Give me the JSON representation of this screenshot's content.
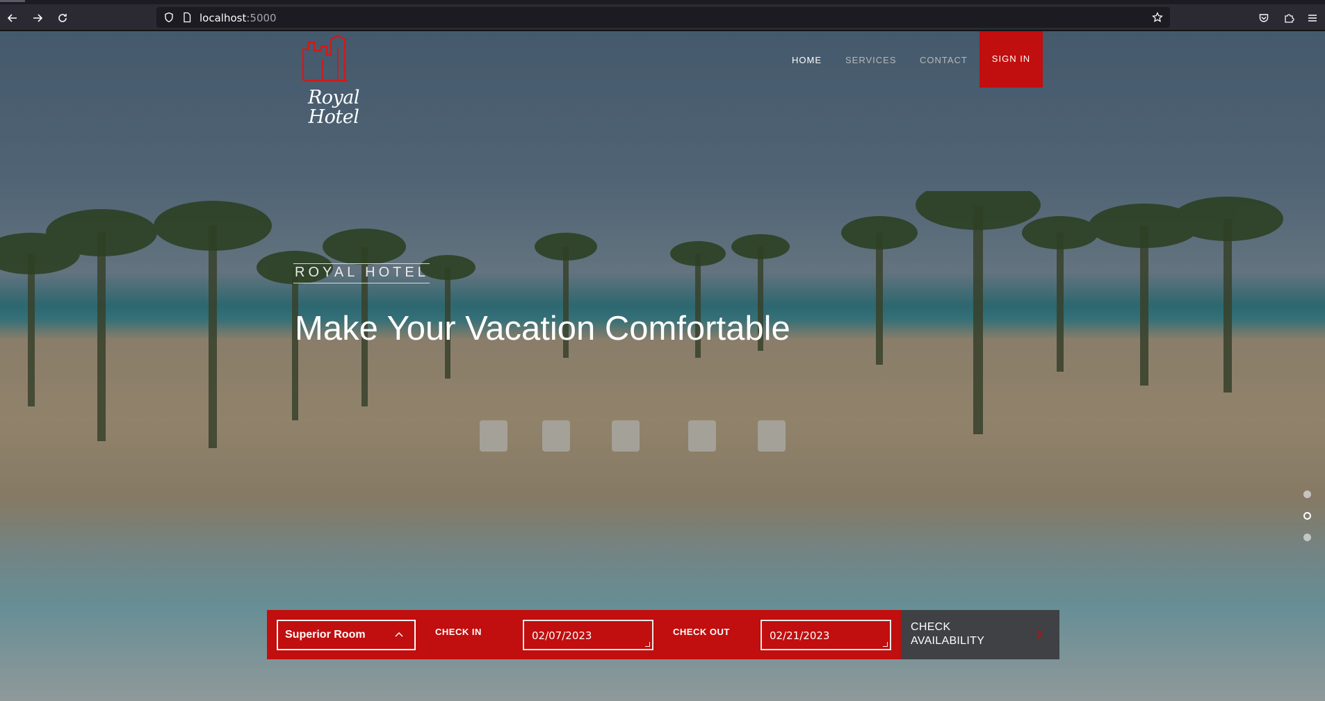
{
  "browser": {
    "url_host": "localhost",
    "url_port": ":5000"
  },
  "brand": {
    "logo_line1": "Royal",
    "logo_line2": "Hotel"
  },
  "nav": {
    "items": [
      {
        "label": "HOME"
      },
      {
        "label": "SERVICES"
      },
      {
        "label": "CONTACT"
      }
    ],
    "signin_label": "SIGN IN"
  },
  "hero": {
    "eyebrow": "ROYAL HOTEL",
    "headline": "Make Your Vacation Comfortable"
  },
  "booking": {
    "room_value": "Superior Room",
    "checkin_label": "CHECK IN",
    "checkin_value": "02/07/2023",
    "checkout_label": "CHECK OUT",
    "checkout_value": "02/21/2023",
    "check_line1": "CHECK",
    "check_line2": "AVAILABILITY"
  },
  "colors": {
    "accent": "#c10e0e",
    "check_button": "#3f4145"
  }
}
